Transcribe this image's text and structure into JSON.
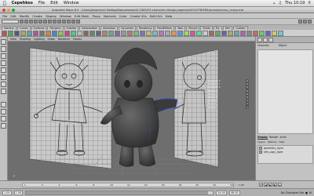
{
  "menubar": {
    "app": "Cepehkos",
    "items": [
      "File",
      "Edit",
      "Window"
    ],
    "clock": "Thu 10:19"
  },
  "window": {
    "title": "Autodesk Maya 8.5 - /Users/Jessenrich Dektop/Nancebelute/4 2009/CS-character design-projects/HCOUTSEERS/scenes/nancy_maya.mb"
  },
  "maya_menu": [
    "File",
    "Edit",
    "Modify",
    "Create",
    "Display",
    "Window",
    "Edit Mesh",
    "Proxy",
    "Normals",
    "Color",
    "Create UVs",
    "Edit UVs",
    "Help"
  ],
  "shelf_tabs": [
    "General",
    "Curves",
    "Surfaces",
    "Polygons",
    "Subdivs",
    "Deformation",
    "Animation",
    "Dynamics",
    "Rendering",
    "PaintEffects",
    "Toon",
    "Muscle",
    "Fluids",
    "Fur",
    "Hair",
    "Custom"
  ],
  "shelf_active_tab": "General",
  "panel_menu": [
    "View",
    "Shading",
    "Lighting",
    "Show",
    "Renderer",
    "Panels"
  ],
  "channel_box": [
    {
      "label": "Translate X",
      "value": "0"
    },
    {
      "label": "Translate Y",
      "value": "0"
    },
    {
      "label": "Translate Z",
      "value": "0"
    },
    {
      "label": "Rotate X",
      "value": "0"
    },
    {
      "label": "Rotate Y",
      "value": "0"
    },
    {
      "label": "Rotate Z",
      "value": "0"
    },
    {
      "label": "Scale X",
      "value": "1"
    },
    {
      "label": "Scale Y",
      "value": "1"
    },
    {
      "label": "Scale Z",
      "value": "1"
    }
  ],
  "right_panel": {
    "col1": "Channels",
    "col2": "Object"
  },
  "layers": {
    "tabs": [
      "Display",
      "Render",
      "Anim"
    ],
    "menu": [
      "Layers",
      "Options",
      "Help"
    ],
    "rows": [
      {
        "name": "geometry_layer",
        "vis": "V"
      },
      {
        "name": "refs_copy_layer",
        "vis": "V"
      }
    ]
  },
  "timeline": {
    "ticks": [
      "1",
      "2",
      "4",
      "6",
      "8",
      "10",
      "12",
      "14",
      "16",
      "18",
      "20",
      "22",
      "24"
    ],
    "current": "1.00"
  },
  "range": {
    "start": "1.00",
    "start_inner": "1.00",
    "end_inner": "24.00",
    "end": "48.00",
    "char_set": "No Character Set"
  },
  "colors": {
    "viewport_bg": "#6e6e6e",
    "model": "#4a4a4a",
    "selection": "#3b5ad6"
  }
}
